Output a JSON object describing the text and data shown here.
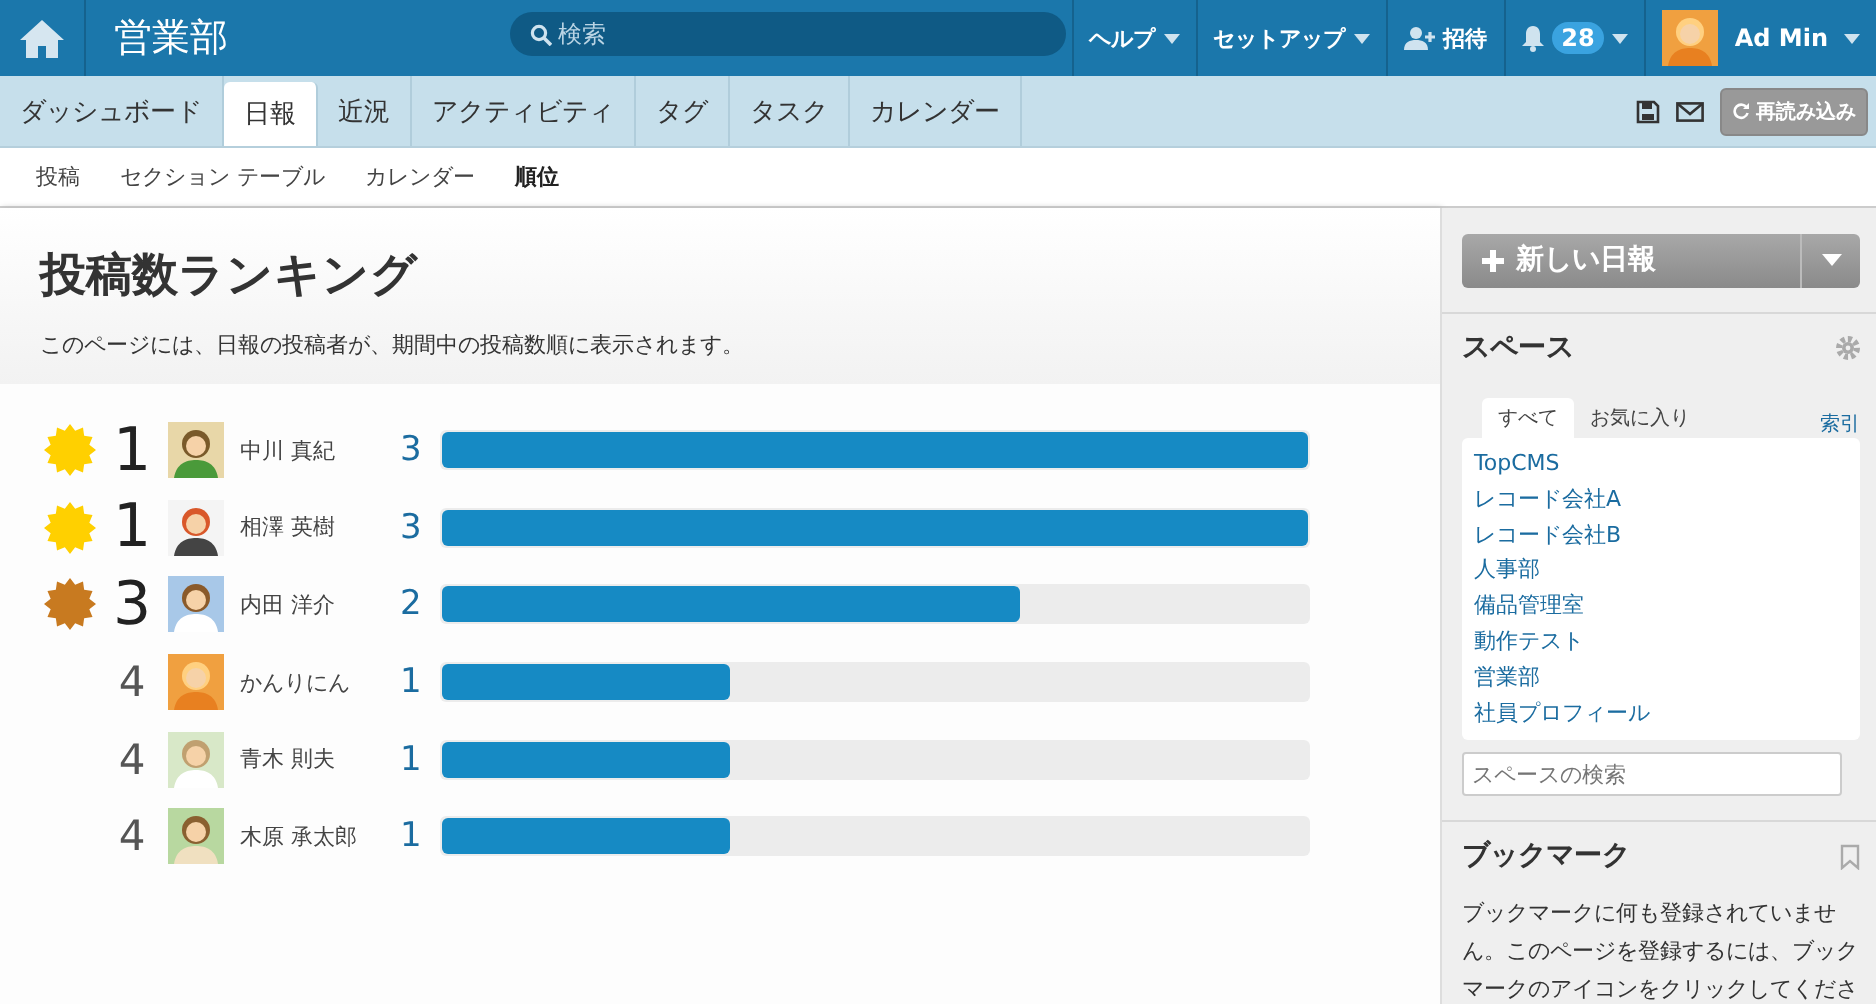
{
  "header": {
    "title": "営業部",
    "search": {
      "placeholder": "検索"
    },
    "menus": [
      {
        "label": "ヘルプ",
        "kind": "dropdown"
      },
      {
        "label": "セットアップ",
        "kind": "dropdown"
      },
      {
        "label": "招待",
        "kind": "invite"
      },
      {
        "label": "28",
        "kind": "notifications"
      }
    ],
    "user": {
      "name": "Ad Min"
    }
  },
  "tabs": [
    {
      "label": "ダッシュボード",
      "selected": false
    },
    {
      "label": "日報",
      "selected": true
    },
    {
      "label": "近況",
      "selected": false
    },
    {
      "label": "アクティビティ",
      "selected": false
    },
    {
      "label": "タグ",
      "selected": false
    },
    {
      "label": "タスク",
      "selected": false
    },
    {
      "label": "カレンダー",
      "selected": false
    }
  ],
  "reload_button": "再読み込み",
  "subnav": [
    {
      "label": "投稿",
      "selected": false
    },
    {
      "label": "セクション テーブル",
      "selected": false
    },
    {
      "label": "カレンダー",
      "selected": false
    },
    {
      "label": "順位",
      "selected": true
    }
  ],
  "page": {
    "title": "投稿数ランキング",
    "description": "このページには、日報の投稿者が、期間中の投稿数順に表示されます。"
  },
  "ranking": [
    {
      "color": "#ffd000",
      "rank": "1",
      "name": "中川 真紀",
      "count": "3",
      "level": 1.0
    },
    {
      "color": "#ffd000",
      "rank": "1",
      "name": "相澤 英樹",
      "count": "3",
      "level": 1.0
    },
    {
      "color": "#c87a20",
      "rank": "3",
      "name": "内田 洋介",
      "count": "2",
      "level": 0.667
    },
    {
      "rank": "4",
      "name": "かんりにん",
      "count": "1",
      "level": 0.333
    },
    {
      "rank": "4",
      "name": "青木 則夫",
      "count": "1",
      "level": 0.333
    },
    {
      "rank": "4",
      "name": "木原 承太郎",
      "count": "1",
      "level": 0.333
    }
  ],
  "sidebar": {
    "new_button": "新しい日報",
    "spaces": {
      "title": "スペース",
      "tabs": [
        {
          "label": "すべて",
          "selected": true
        },
        {
          "label": "お気に入り",
          "selected": false
        }
      ],
      "index_link": "索引",
      "items": [
        "TopCMS",
        "レコード会社A",
        "レコード会社B",
        "人事部",
        "備品管理室",
        "動作テスト",
        "営業部",
        "社員プロフィール"
      ],
      "search": {
        "placeholder": "スペースの検索"
      }
    },
    "bookmarks": {
      "title": "ブックマーク",
      "text": "ブックマークに何も登録されていません。このページを登録するには、ブックマークのアイコンをクリックしてくださ"
    }
  }
}
